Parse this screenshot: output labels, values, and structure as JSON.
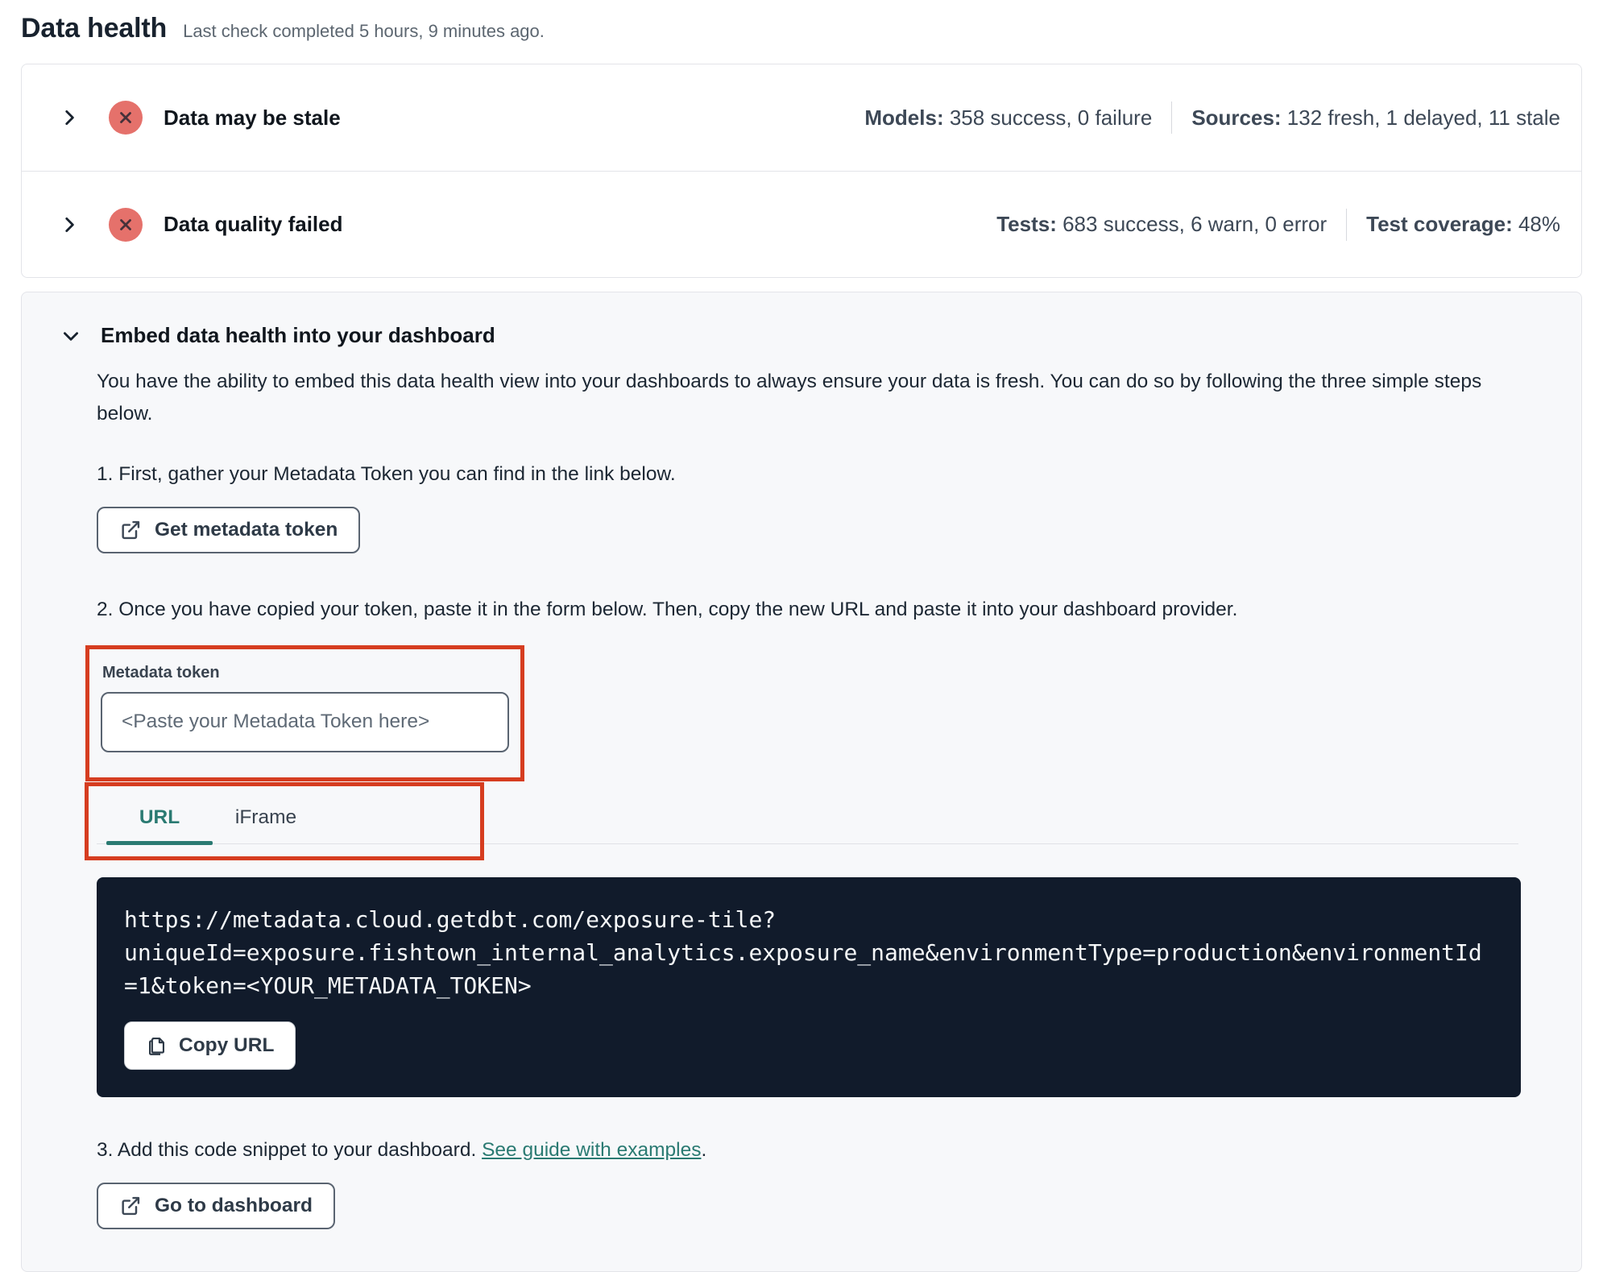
{
  "page": {
    "title": "Data health",
    "subtitle": "Last check completed 5 hours, 9 minutes ago."
  },
  "status_rows": [
    {
      "label": "Data may be stale",
      "icon": "x-circle-icon",
      "stats": [
        {
          "label": "Models:",
          "value": " 358 success, 0 failure"
        },
        {
          "label": "Sources:",
          "value": " 132 fresh, 1 delayed, 11 stale"
        }
      ]
    },
    {
      "label": "Data quality failed",
      "icon": "x-circle-icon",
      "stats": [
        {
          "label": "Tests:",
          "value": " 683 success, 6 warn, 0 error"
        },
        {
          "label": "Test coverage:",
          "value": " 48%"
        }
      ]
    }
  ],
  "embed": {
    "title": "Embed data health into your dashboard",
    "description": "You have the ability to embed this data health view into your dashboards to always ensure your data is fresh. You can do so by following the three simple steps below.",
    "step1": {
      "text": "1. First, gather your Metadata Token you can find in the link below.",
      "button_label": "Get metadata token"
    },
    "step2": {
      "text": "2. Once you have copied your token, paste it in the form below. Then, copy the new URL and paste it into your dashboard provider.",
      "token_field": {
        "label": "Metadata token",
        "placeholder": "<Paste your Metadata Token here>"
      },
      "tabs": [
        {
          "label": "URL"
        },
        {
          "label": "iFrame"
        }
      ],
      "active_tab": "URL",
      "url": "https://metadata.cloud.getdbt.com/exposure-tile?uniqueId=exposure.fishtown_internal_analytics.exposure_name&environmentType=production&environmentId=1&token=<YOUR_METADATA_TOKEN>",
      "url_lines": [
        "https://metadata.cloud.getdbt.com/exposure-tile?",
        "uniqueId=exposure.fishtown_internal_analytics.exposure_name&environmentType=production&environmentId",
        "=1&token=<YOUR_METADATA_TOKEN>"
      ],
      "copy_button_label": "Copy URL"
    },
    "step3": {
      "text_before_link": "3. Add this code snippet to your dashboard. ",
      "link_text": "See guide with examples",
      "text_after_link": ".",
      "button_label": "Go to dashboard"
    }
  },
  "colors": {
    "accent_teal": "#2a7a72",
    "annotation_red": "#d63d20",
    "error_icon_bg": "#e5716b",
    "code_block_bg": "#111b2b"
  }
}
